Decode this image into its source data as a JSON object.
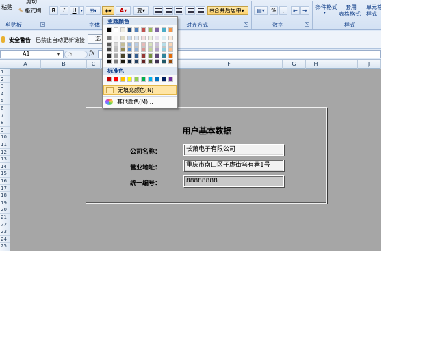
{
  "ribbon": {
    "clipboard": {
      "paste_label": "粘贴",
      "cut_label": "剪切",
      "format_painter_label": "格式刷",
      "group_label": "剪贴板"
    },
    "font": {
      "bold": "B",
      "italic": "I",
      "underline": "U",
      "font_color_glyph": "A",
      "wen_glyph": "变",
      "group_label": "字体"
    },
    "alignment": {
      "merge_center_label": "合并后居中",
      "group_label": "对齐方式"
    },
    "number": {
      "percent": "%",
      "comma": ",",
      "group_label": "数字"
    },
    "styles": {
      "conditional_line1": "条件格式",
      "format_table_line1": "套用",
      "format_table_line2": "表格格式",
      "cell_styles_line1": "单元格",
      "cell_styles_line2": "样式",
      "group_label": "样式"
    }
  },
  "security_bar": {
    "title": "安全警告",
    "message": "已禁止自动更新链接",
    "options_label": "选"
  },
  "formula_bar": {
    "name_box": "A1",
    "fx": "fx",
    "formula": ""
  },
  "columns": [
    "A",
    "B",
    "C",
    "F",
    "G",
    "H",
    "I",
    "J"
  ],
  "rows": [
    "1",
    "2",
    "3",
    "4",
    "5",
    "6",
    "7",
    "8",
    "9",
    "10",
    "11",
    "12",
    "13",
    "14",
    "15",
    "16",
    "17",
    "18",
    "19",
    "20",
    "21",
    "22",
    "23",
    "24",
    "25"
  ],
  "form": {
    "title": "用户基本数据",
    "fields": [
      {
        "label": "公司名称：",
        "value": "长萧电子有限公司"
      },
      {
        "label": "营业地址：",
        "value": "重庆市南山区子虚街乌有巷1号"
      },
      {
        "label": "统一编号：",
        "value": "88888888"
      }
    ]
  },
  "fill_palette": {
    "theme_header": "主题颜色",
    "theme_top_row": [
      "#000000",
      "#ffffff",
      "#eeece1",
      "#1f497d",
      "#4f81bd",
      "#c0504d",
      "#9bbb59",
      "#8064a2",
      "#4bacc6",
      "#f79646"
    ],
    "theme_shades": [
      [
        "#7f7f7f",
        "#f2f2f2",
        "#ddd9c3",
        "#c6d9f0",
        "#dbe5f1",
        "#f2dcdb",
        "#ebf1dd",
        "#e5e0ec",
        "#dbeef3",
        "#fdeada"
      ],
      [
        "#595959",
        "#d8d8d8",
        "#c4bd97",
        "#8db3e2",
        "#b8cce4",
        "#e5b9b7",
        "#d7e3bc",
        "#ccc1d9",
        "#b7dde8",
        "#fbd5b5"
      ],
      [
        "#3f3f3f",
        "#bfbfbf",
        "#938953",
        "#548dd4",
        "#95b3d7",
        "#d99694",
        "#c3d69b",
        "#b2a2c7",
        "#92cddc",
        "#fac08f"
      ],
      [
        "#262626",
        "#a5a5a5",
        "#494429",
        "#17365d",
        "#366092",
        "#953734",
        "#76923c",
        "#5f497a",
        "#31859b",
        "#e36c09"
      ],
      [
        "#0c0c0c",
        "#7f7f7f",
        "#1d1b10",
        "#0f243e",
        "#244061",
        "#632423",
        "#4f6128",
        "#3f3151",
        "#205867",
        "#974806"
      ]
    ],
    "standard_header": "标准色",
    "standard_colors": [
      "#c00000",
      "#ff0000",
      "#ffc000",
      "#ffff00",
      "#92d050",
      "#00b050",
      "#00b0f0",
      "#0070c0",
      "#002060",
      "#7030a0"
    ],
    "no_fill_label": "无填充颜色(N)",
    "more_colors_label": "其他颜色(M)..."
  }
}
